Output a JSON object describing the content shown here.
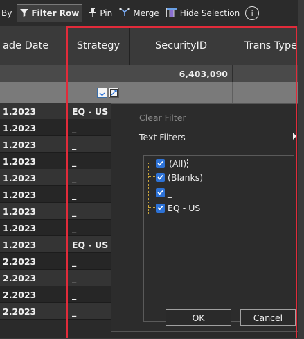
{
  "toolbar": {
    "by_label": "By",
    "filter_row_label": "Filter Row",
    "pin_label": "Pin",
    "merge_label": "Merge",
    "hide_selection_label": "Hide Selection",
    "info_label": "i"
  },
  "columns": {
    "trade_date": "ade Date",
    "strategy": "Strategy",
    "security_id": "SecurityID",
    "trans_type": "Trans Type"
  },
  "summary": {
    "security_id_total": "6,403,090"
  },
  "rows": [
    {
      "date": "1.2023",
      "strategy": "EQ - US"
    },
    {
      "date": "1.2023",
      "strategy": "_"
    },
    {
      "date": "1.2023",
      "strategy": "_"
    },
    {
      "date": "1.2023",
      "strategy": "_"
    },
    {
      "date": "1.2023",
      "strategy": "_"
    },
    {
      "date": "1.2023",
      "strategy": "_"
    },
    {
      "date": "1.2023",
      "strategy": "_"
    },
    {
      "date": "1.2023",
      "strategy": "_"
    },
    {
      "date": "1.2023",
      "strategy": "EQ - US"
    },
    {
      "date": "2.2023",
      "strategy": "_"
    },
    {
      "date": "2.2023",
      "strategy": "_"
    },
    {
      "date": "2.2023",
      "strategy": "_"
    },
    {
      "date": "2.2023",
      "strategy": "_"
    }
  ],
  "filter_menu": {
    "clear_filter": "Clear Filter",
    "text_filters": "Text Filters",
    "values": [
      {
        "label": "(All)",
        "checked": true
      },
      {
        "label": "(Blanks)",
        "checked": true
      },
      {
        "label": "_",
        "checked": true
      },
      {
        "label": "EQ - US",
        "checked": true
      }
    ],
    "ok_label": "OK",
    "cancel_label": "Cancel"
  },
  "colors": {
    "accent_red": "#e12b3a",
    "checkbox_blue": "#2d72d6"
  }
}
